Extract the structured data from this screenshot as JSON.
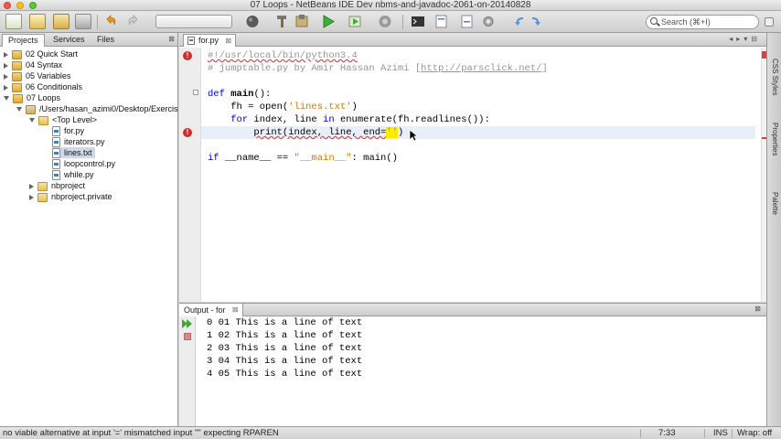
{
  "window": {
    "title": "07 Loops - NetBeans IDE Dev nbms-and-javadoc-2061-on-20140828"
  },
  "toolbar": {
    "buttons": [
      "new-file-icon",
      "new-project-icon",
      "open-project-icon",
      "close-project-icon",
      "undo-icon",
      "redo-icon",
      "clean-build-icon",
      "build-icon",
      "build-hammer-icon",
      "run-icon",
      "debug-icon",
      "profile-icon",
      "terminal-icon",
      "bookmark-icon",
      "back-icon",
      "forward-icon"
    ],
    "search_placeholder": "Search (⌘+I)"
  },
  "left_panel": {
    "tabs": [
      "Projects",
      "Services",
      "Files"
    ],
    "tree": [
      {
        "label": "02 Quick Start"
      },
      {
        "label": "04 Syntax"
      },
      {
        "label": "05 Variables"
      },
      {
        "label": "06 Conditionals"
      },
      {
        "label": "07 Loops"
      },
      {
        "label": "/Users/hasan_azimi0/Desktop/Exercis"
      },
      {
        "label": "<Top Level>"
      },
      {
        "label": "for.py"
      },
      {
        "label": "iterators.py"
      },
      {
        "label": "lines.txt"
      },
      {
        "label": "loopcontrol.py"
      },
      {
        "label": "while.py"
      },
      {
        "label": "nbproject"
      },
      {
        "label": "nbproject.private"
      }
    ]
  },
  "editor": {
    "tab_label": "for.py",
    "lines": {
      "shebang": "#!/usr/local/bin/python3.4",
      "comment_prefix": "# jumptable.py by Amir Hassan Azimi [",
      "comment_url": "http://parsclick.net/",
      "comment_suffix": "]",
      "def_kw": "def",
      "def_name": "main",
      "def_rest": "():",
      "fh_line_a": "    fh = open(",
      "fh_str": "'lines.txt'",
      "fh_line_b": ")",
      "for_indent": "    ",
      "for_kw": "for",
      "for_mid": " index, line ",
      "in_kw": "in",
      "for_rest": " enumerate(fh.readlines()):",
      "print_indent": "        ",
      "print_call": "print(index, line, end=",
      "print_str": "''",
      "print_end": ")",
      "if_kw": "if",
      "if_mid": " __name__ == ",
      "if_str": "\"__main__\"",
      "if_rest": ": main()"
    }
  },
  "right_sidebar": {
    "tabs": [
      "CSS Styles",
      "Properties",
      "Palette"
    ]
  },
  "output": {
    "tab_label": "Output - for",
    "lines": [
      "0 01 This is a line of text",
      "1 02 This is a line of text",
      "2 03 This is a line of text",
      "3 04 This is a line of text",
      "4 05 This is a line of text"
    ]
  },
  "statusbar": {
    "message": "no viable alternative at input '='  mismatched input '\"' expecting RPAREN",
    "position": "7:33",
    "mode": "INS",
    "wrap": "Wrap: off"
  }
}
